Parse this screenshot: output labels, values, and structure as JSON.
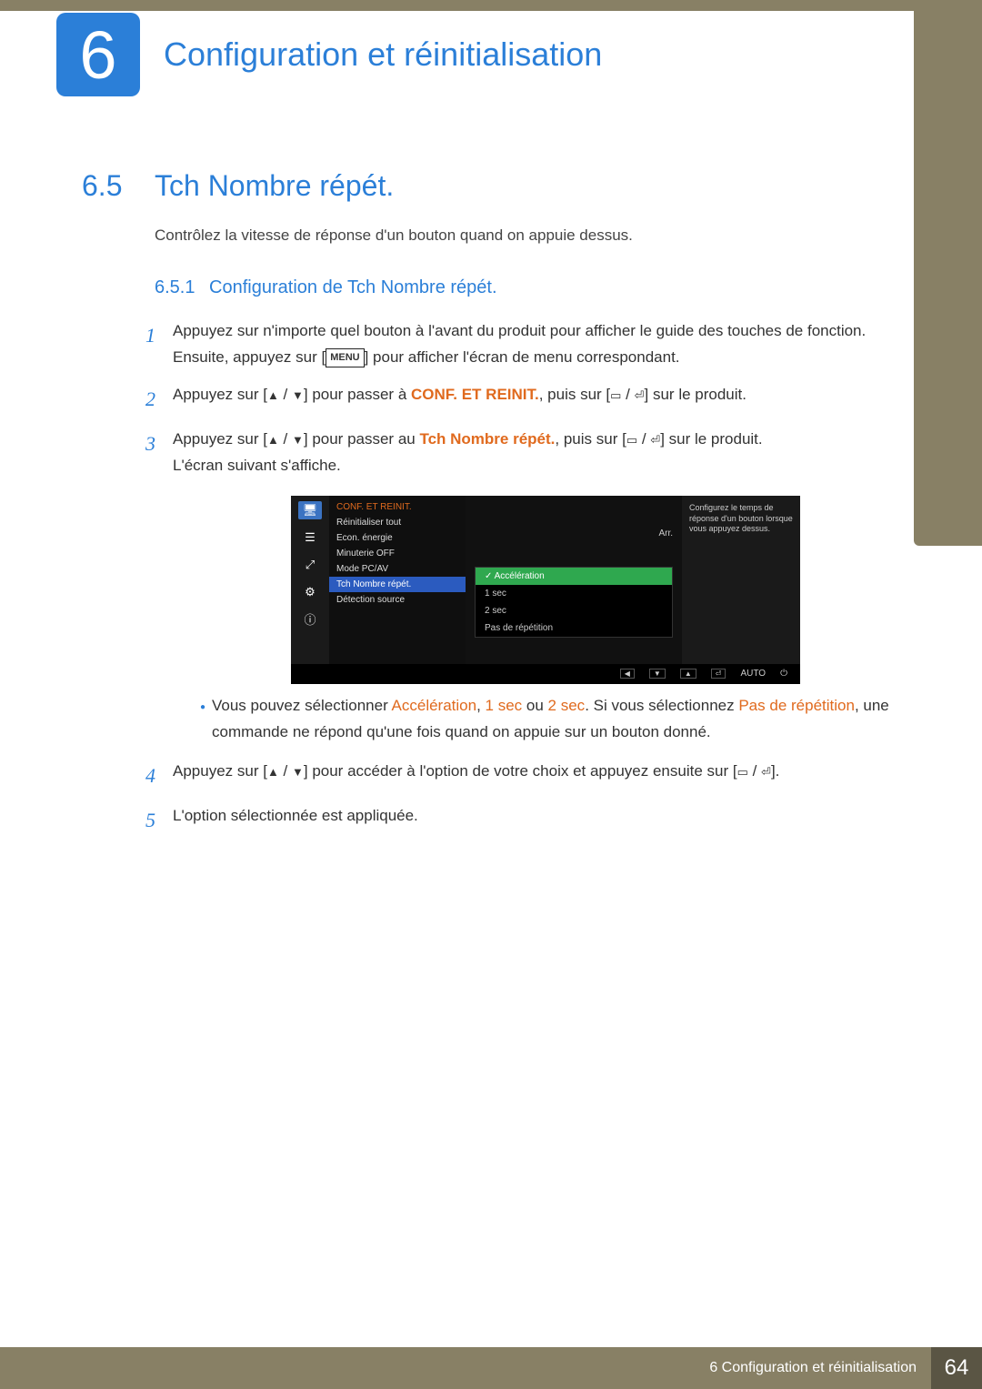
{
  "chapter": {
    "number": "6",
    "title": "Configuration et réinitialisation"
  },
  "section": {
    "number": "6.5",
    "title": "Tch Nombre répét."
  },
  "intro": "Contrôlez la vitesse de réponse d'un bouton quand on appuie dessus.",
  "subsection": {
    "number": "6.5.1",
    "title": "Configuration de Tch Nombre répét."
  },
  "steps": {
    "s1a": "Appuyez sur n'importe quel bouton à l'avant du produit pour afficher le guide des touches de fonction. Ensuite, appuyez sur [",
    "s1b": "] pour afficher l'écran de menu correspondant.",
    "menu_label": "MENU",
    "s2a": "Appuyez sur [",
    "s2b": "] pour passer à ",
    "s2hl": "CONF. ET REINIT.",
    "s2c": ", puis sur [",
    "s2d": "] sur le produit.",
    "s3a": "Appuyez sur [",
    "s3b": "] pour passer au ",
    "s3hl": "Tch Nombre répét.",
    "s3c": ", puis sur [",
    "s3d": "] sur le produit.",
    "s3e": "L'écran suivant s'affiche.",
    "s4a": "Appuyez sur [",
    "s4b": "] pour accéder à l'option de votre choix et appuyez ensuite sur [",
    "s4c": "].",
    "s5": "L'option sélectionnée est appliquée."
  },
  "bullet": {
    "a": "Vous pouvez sélectionner ",
    "hl1": "Accélération",
    "hl2": "1 sec",
    "hl3": "2 sec",
    "mid1": ", ",
    "mid2": " ou ",
    "mid3": ". Si vous sélectionnez ",
    "hl4": "Pas de répétition",
    "b": ", une commande ne répond qu'une fois quand on appuie sur un bouton donné."
  },
  "osd": {
    "header": "CONF. ET REINIT.",
    "items": [
      "Réinitialiser tout",
      "Econ. énergie",
      "Minuterie OFF",
      "Mode PC/AV",
      "Tch Nombre répét.",
      "Détection source"
    ],
    "value_arr": "Arr.",
    "options": [
      "Accélération",
      "1 sec",
      "2 sec",
      "Pas de répétition"
    ],
    "help": "Configurez le temps de réponse d'un bouton lorsque vous appuyez dessus.",
    "foot_auto": "AUTO"
  },
  "footer": {
    "text": "6 Configuration et réinitialisation",
    "page": "64"
  }
}
